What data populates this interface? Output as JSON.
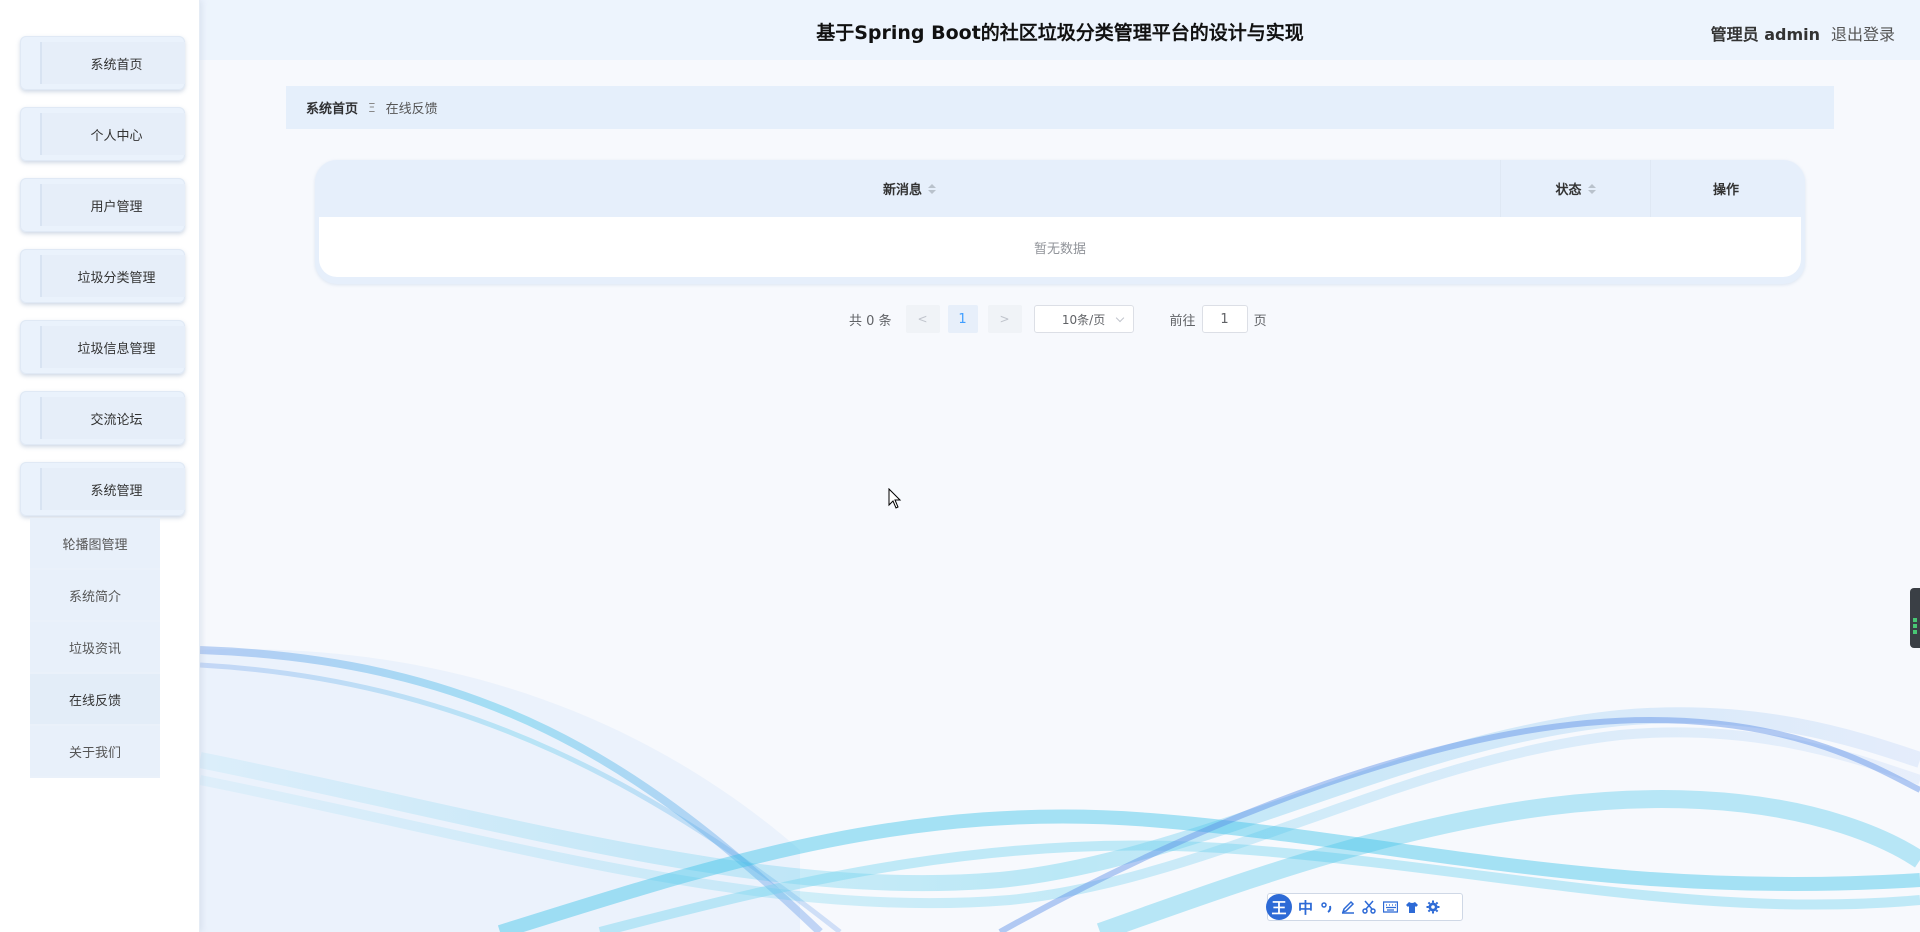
{
  "header": {
    "title": "基于Spring Boot的社区垃圾分类管理平台的设计与实现",
    "user": "管理员 admin",
    "logout": "退出登录"
  },
  "sidebar": {
    "items": [
      {
        "label": "系统首页"
      },
      {
        "label": "个人中心"
      },
      {
        "label": "用户管理"
      },
      {
        "label": "垃圾分类管理"
      },
      {
        "label": "垃圾信息管理"
      },
      {
        "label": "交流论坛"
      },
      {
        "label": "系统管理"
      }
    ],
    "submenu": [
      {
        "label": "轮播图管理"
      },
      {
        "label": "系统简介"
      },
      {
        "label": "垃圾资讯"
      },
      {
        "label": "在线反馈"
      },
      {
        "label": "关于我们"
      }
    ]
  },
  "breadcrumb": {
    "home": "系统首页",
    "separator": "Ξ",
    "current": "在线反馈"
  },
  "table": {
    "columns": [
      "新消息",
      "状态",
      "操作"
    ],
    "empty_text": "暂无数据"
  },
  "pagination": {
    "total": "共 0 条",
    "prev": "<",
    "next": ">",
    "current_page": "1",
    "page_size": "10条/页",
    "goto_label": "前往",
    "goto_value": "1",
    "page_suffix": "页"
  },
  "ime": {
    "logo": "王",
    "mode": "中"
  },
  "colors": {
    "header_bg": "#edf4fd",
    "accent": "#409eff",
    "wave_blue": "#5b8fe6",
    "wave_cyan": "#3fc4e8"
  }
}
